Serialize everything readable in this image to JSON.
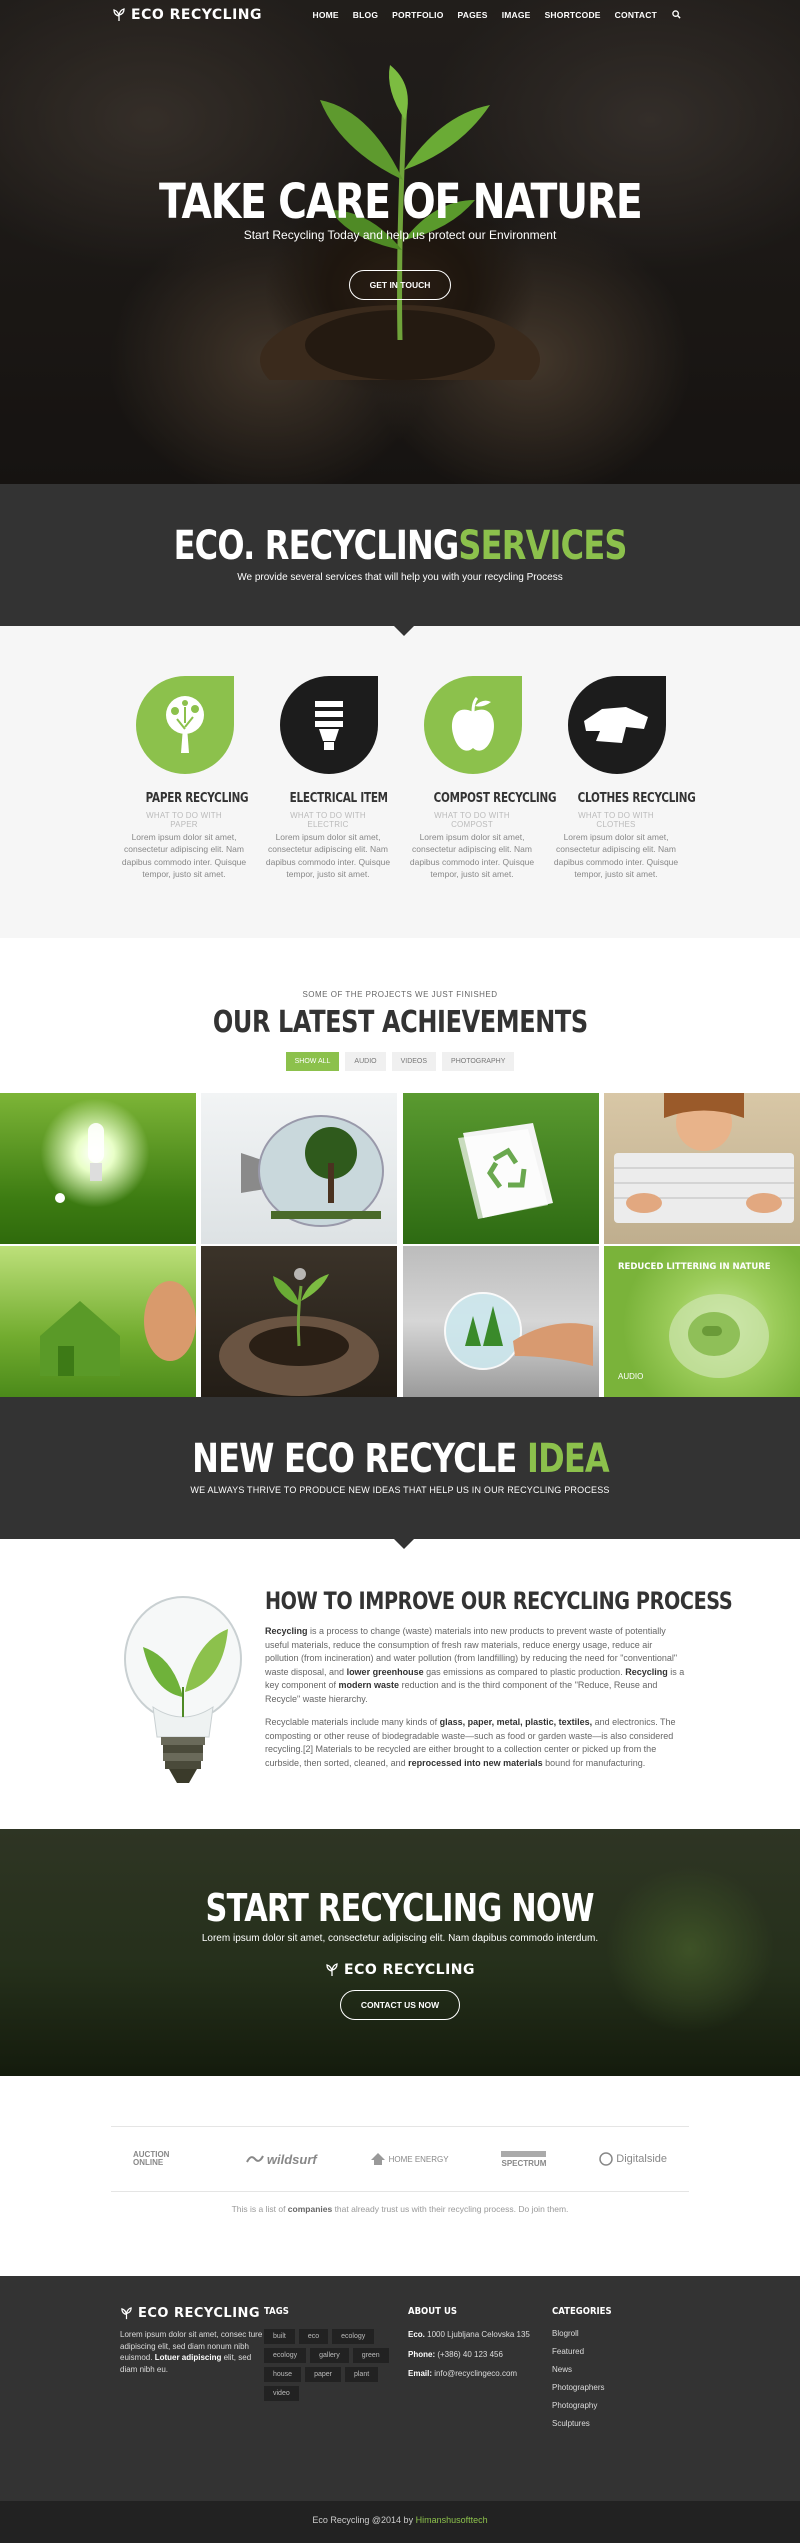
{
  "nav": {
    "logo": "ECO RECYCLING",
    "items": [
      "HOME",
      "BLOG",
      "PORTFOLIO",
      "PAGES",
      "IMAGE",
      "SHORTCODE",
      "CONTACT"
    ],
    "search_icon": "search-icon"
  },
  "hero": {
    "title": "TAKE CARE OF NATURE",
    "subtitle": "Start Recycling Today and help us protect our Environment",
    "button": "GET IN TOUCH"
  },
  "services_head": {
    "title_a": "ECO. RECYCLING",
    "title_b": "SERVICES",
    "subtitle": "We provide several services that will help you with your recycling Process"
  },
  "services": [
    {
      "icon": "tree-icon",
      "title": "PAPER RECYCLING",
      "sub": "WHAT TO DO WITH PAPER",
      "text": "Lorem ipsum dolor sit amet, consectetur adipiscing elit. Nam dapibus commodo inter. Quisque tempor, justo sit amet."
    },
    {
      "icon": "lightbulb-icon",
      "title": "ELECTRICAL ITEM",
      "sub": "WHAT TO DO WITH ELECTRIC",
      "text": "Lorem ipsum dolor sit amet, consectetur adipiscing elit. Nam dapibus commodo inter. Quisque tempor, justo sit amet."
    },
    {
      "icon": "apple-icon",
      "title": "COMPOST RECYCLING",
      "sub": "WHAT TO DO WITH COMPOST",
      "text": "Lorem ipsum dolor sit amet, consectetur adipiscing elit. Nam dapibus commodo inter. Quisque tempor, justo sit amet."
    },
    {
      "icon": "clothes-icon",
      "title": "CLOTHES RECYCLING",
      "sub": "WHAT TO DO WITH CLOTHES",
      "text": "Lorem ipsum dolor sit amet, consectetur adipiscing elit. Nam dapibus commodo inter. Quisque tempor, justo sit amet."
    }
  ],
  "achievements": {
    "pretitle": "SOME OF THE PROJECTS WE JUST FINISHED",
    "title": "OUR LATEST ACHIEVEMENTS",
    "filters": [
      "SHOW ALL",
      "AUDIO",
      "VIDEOS",
      "PHOTOGRAPHY"
    ],
    "tile_label": "REDUCED LITTERING IN NATURE",
    "tile_category": "AUDIO"
  },
  "idea_head": {
    "title_a": "NEW ECO RECYCLE",
    "title_b": "IDEA",
    "subtitle": "WE ALWAYS THRIVE TO PRODUCE NEW IDEAS THAT HELP US IN OUR RECYCLING PROCESS"
  },
  "improve": {
    "title": "HOW TO IMPROVE OUR RECYCLING PROCESS",
    "p1_a": "Recycling",
    "p1_b": " is a process to change (waste) materials into new products to prevent waste of potentially useful materials, reduce the consumption of fresh raw materials, reduce energy usage, reduce air pollution (from incineration) and water pollution (from landfilling) by reducing the need for \"conventional\" waste disposal, and ",
    "p1_c": "lower greenhouse",
    "p1_d": " gas emissions as compared to plastic production. ",
    "p1_e": "Recycling",
    "p1_f": " is a key component of ",
    "p1_g": "modern waste",
    "p1_h": " reduction and is the third component of the \"Reduce, Reuse and Recycle\" waste hierarchy.",
    "p2_a": "Recyclable materials include many kinds of ",
    "p2_b": "glass, paper, metal, plastic, textiles,",
    "p2_c": " and electronics. The composting or other reuse of biodegradable waste—such as food or garden waste—is also considered recycling.[2] Materials to be recycled are either brought to a collection center or picked up from the curbside, then sorted, cleaned, and ",
    "p2_d": "reprocessed into new materials",
    "p2_e": " bound for manufacturing."
  },
  "cta": {
    "title": "START RECYCLING NOW",
    "subtitle": "Lorem ipsum dolor sit amet, consectetur adipiscing elit. Nam dapibus commodo interdum.",
    "logo": "ECO RECYCLING",
    "button": "CONTACT US NOW"
  },
  "clients": {
    "logos": [
      "AUCTION ONLINE",
      "wildsurf",
      "HOME ENERGY",
      "SPECTRUM",
      "Digitalside"
    ],
    "note_a": "This is a list of ",
    "note_b": "companies",
    "note_c": " that already trust us with their recycling process. Do join them."
  },
  "footer": {
    "logo": "ECO RECYCLING",
    "about_a": "Lorem ipsum dolor sit amet, consec ture adipiscing elit, sed diam nonum nibh euismod. ",
    "about_b": "Lotuer adipiscing",
    "about_c": " elit, sed diam nibh eu.",
    "tags_title": "TAGS",
    "tags": [
      "built",
      "eco",
      "ecology",
      "ecology",
      "gallery",
      "green",
      "house",
      "paper",
      "plant",
      "video"
    ],
    "aboutus_title": "ABOUT US",
    "addr_label": "Eco.",
    "addr": " 1000 Ljubljana Celovska 135",
    "phone_label": "Phone:",
    "phone": " (+386) 40 123 456",
    "email_label": "Email:",
    "email": " info@recyclingeco.com",
    "cats_title": "CATEGORIES",
    "cats": [
      "Blogroll",
      "Featured",
      "News",
      "Photographers",
      "Photography",
      "Sculptures"
    ]
  },
  "copyright": {
    "text": "Eco Recycling @2014 by ",
    "author": "Himanshusofttech"
  },
  "colors": {
    "accent": "#8cc14c",
    "dark": "#333333"
  }
}
